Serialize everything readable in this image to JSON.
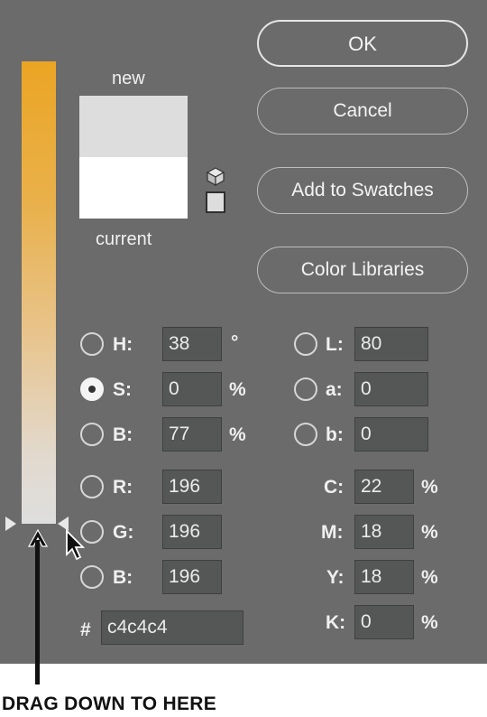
{
  "preview": {
    "new_label": "new",
    "current_label": "current",
    "new_color": "#dddddd",
    "current_color": "#ffffff"
  },
  "buttons": {
    "ok": "OK",
    "cancel": "Cancel",
    "add_swatches": "Add to Swatches",
    "color_libraries": "Color Libraries"
  },
  "hsb": {
    "h": {
      "label": "H:",
      "value": "38",
      "unit": "°"
    },
    "s": {
      "label": "S:",
      "value": "0",
      "unit": "%"
    },
    "b": {
      "label": "B:",
      "value": "77",
      "unit": "%"
    }
  },
  "rgb": {
    "r": {
      "label": "R:",
      "value": "196"
    },
    "g": {
      "label": "G:",
      "value": "196"
    },
    "b": {
      "label": "B:",
      "value": "196"
    }
  },
  "lab": {
    "l": {
      "label": "L:",
      "value": "80"
    },
    "a": {
      "label": "a:",
      "value": "0"
    },
    "b": {
      "label": "b:",
      "value": "0"
    }
  },
  "cmyk": {
    "c": {
      "label": "C:",
      "value": "22",
      "unit": "%"
    },
    "m": {
      "label": "M:",
      "value": "18",
      "unit": "%"
    },
    "y": {
      "label": "Y:",
      "value": "18",
      "unit": "%"
    },
    "k": {
      "label": "K:",
      "value": "0",
      "unit": "%"
    }
  },
  "hex": {
    "label": "#",
    "value": "c4c4c4"
  },
  "selected_mode": "S",
  "annotation": {
    "text": "DRAG DOWN TO HERE"
  }
}
